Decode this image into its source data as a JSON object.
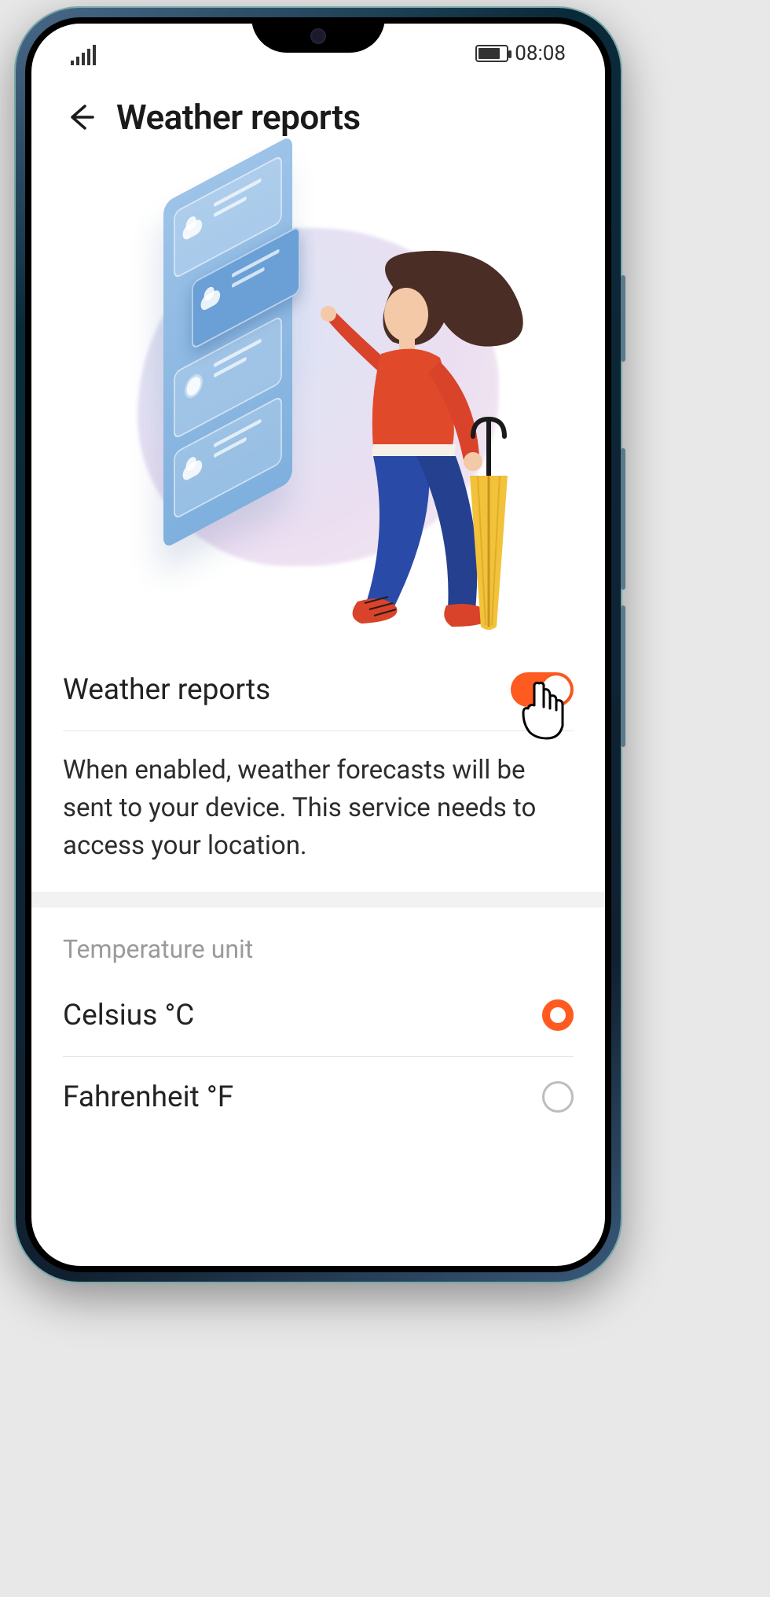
{
  "status": {
    "time": "08:08"
  },
  "header": {
    "title": "Weather reports"
  },
  "toggle_row": {
    "label": "Weather reports",
    "enabled": true,
    "description": "When enabled, weather forecasts will be sent to your device. This service needs to access your location."
  },
  "temperature_unit": {
    "section_label": "Temperature unit",
    "options": [
      {
        "label": "Celsius °C",
        "selected": true
      },
      {
        "label": "Fahrenheit °F",
        "selected": false
      }
    ]
  }
}
